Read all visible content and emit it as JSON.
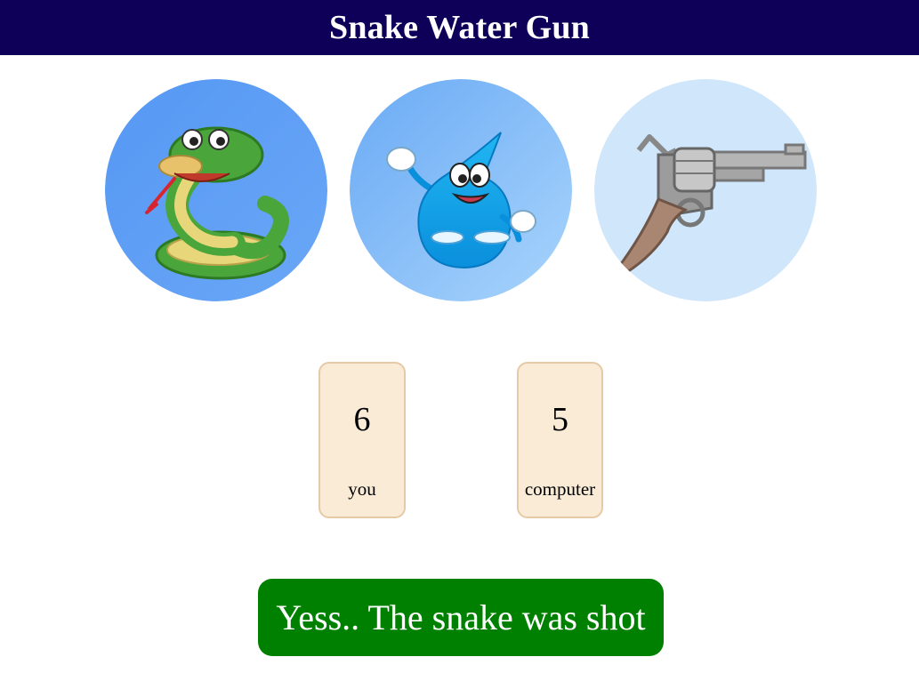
{
  "header": {
    "title": "Snake Water Gun"
  },
  "choices": [
    {
      "id": "snake",
      "icon": "snake-icon",
      "background": "#5a9cf5"
    },
    {
      "id": "water",
      "icon": "water-drop-icon",
      "background": "#8ec5fa"
    },
    {
      "id": "gun",
      "icon": "revolver-icon",
      "background": "#cfe6fb"
    }
  ],
  "scores": {
    "you": {
      "value": "6",
      "label": "you"
    },
    "computer": {
      "value": "5",
      "label": "computer"
    }
  },
  "result": {
    "message": "Yess.. The snake was shot",
    "color": "#008000"
  },
  "colors": {
    "header_bg": "#0e0058",
    "card_bg": "#faebd7",
    "card_border": "#e6c9a6"
  }
}
